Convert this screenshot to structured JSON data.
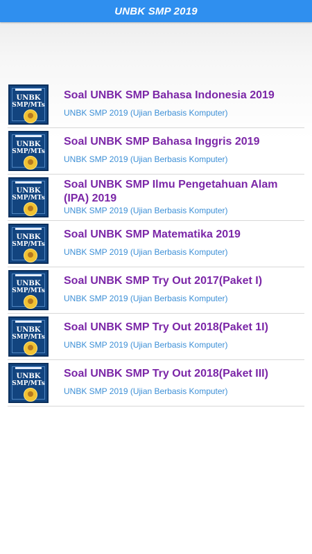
{
  "app_bar": {
    "title": "UNBK SMP 2019",
    "color": "#2f8fef"
  },
  "list": {
    "items": [
      {
        "title": "Soal UNBK SMP Bahasa Indonesia 2019",
        "subtitle": "UNBK SMP 2019 (Ujian Berbasis Komputer)"
      },
      {
        "title": "Soal UNBK SMP Bahasa Inggris 2019",
        "subtitle": "UNBK SMP 2019 (Ujian Berbasis Komputer)"
      },
      {
        "title": "Soal UNBK SMP Ilmu Pengetahuan Alam (IPA) 2019",
        "subtitle": "UNBK SMP 2019 (Ujian Berbasis Komputer)"
      },
      {
        "title": "Soal UNBK SMP Matematika 2019",
        "subtitle": "UNBK SMP 2019 (Ujian Berbasis Komputer)"
      },
      {
        "title": "Soal UNBK SMP Try Out 2017(Paket I)",
        "subtitle": "UNBK SMP 2019 (Ujian Berbasis Komputer)"
      },
      {
        "title": "Soal UNBK SMP Try Out 2018(Paket 1I)",
        "subtitle": "UNBK SMP 2019 (Ujian Berbasis Komputer)"
      },
      {
        "title": "Soal UNBK SMP Try Out 2018(Paket III)",
        "subtitle": "UNBK SMP 2019 (Ujian Berbasis Komputer)"
      }
    ],
    "thumbnail": {
      "line1": "UNBK",
      "line2": "SMP/MTs"
    }
  },
  "colors": {
    "title_text": "#7b26a7",
    "subtitle_text": "#3c8fd6"
  }
}
